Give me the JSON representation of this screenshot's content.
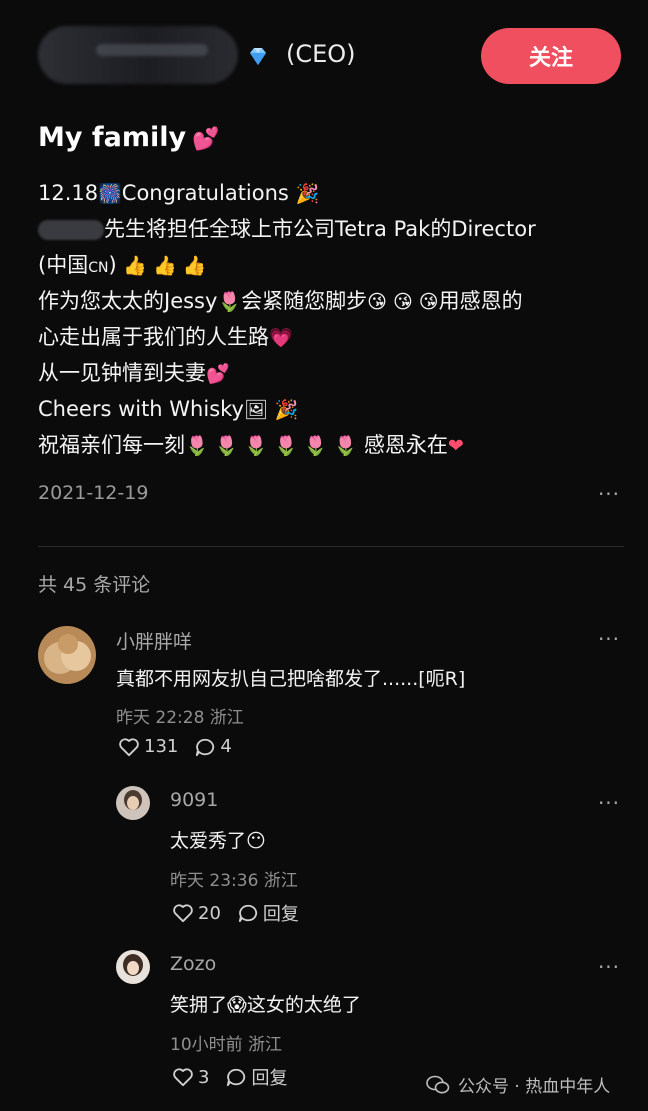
{
  "author": {
    "title": "(CEO)",
    "follow_label": "关注"
  },
  "post": {
    "title": "My family",
    "lines": [
      [
        "12.18",
        "Congratulations"
      ],
      [
        "先生将担任全球上市公司Tetra Pak的Director"
      ],
      [
        "(中国",
        "CN",
        ")"
      ],
      [
        "作为您太太的Jessy",
        "会紧随您脚步",
        "用感恩的"
      ],
      [
        "心走出属于我们的人生路"
      ],
      [
        "从一见钟情到夫妻"
      ],
      [
        "Cheers with Whisky"
      ],
      [
        "祝福亲们每一刻",
        "感恩永在"
      ]
    ],
    "date": "2021-12-19"
  },
  "comments_header": "共 45 条评论",
  "comments": [
    {
      "name": "小胖胖咩",
      "text": "真都不用网友扒自己把啥都发了......[呃R]",
      "meta": "昨天 22:28 浙江",
      "likes": "131",
      "replies": "4"
    },
    {
      "name": "9091",
      "text_before": "太爱秀了",
      "meta": "昨天 23:36 浙江",
      "likes": "20",
      "reply_label": "回复"
    },
    {
      "name": "Zozo",
      "text_before": "笑拥了",
      "text_after": "这女的太绝了",
      "meta": "10小时前 浙江",
      "likes": "3",
      "reply_label": "回复"
    }
  ],
  "watermark": "公众号 · 热血中年人",
  "colors": {
    "accent": "#f04f5f",
    "background": "#0b0b0b"
  },
  "icons": [
    "diamond-icon",
    "heart-icon",
    "comment-icon",
    "more-icon",
    "wechat-icon"
  ]
}
